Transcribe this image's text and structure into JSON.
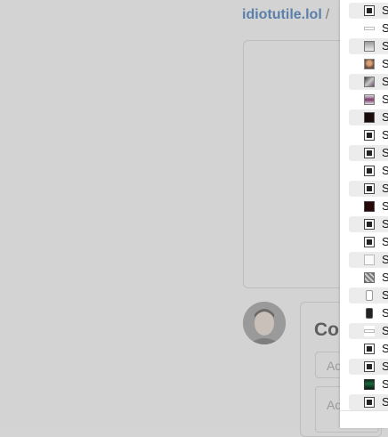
{
  "header": {
    "breadcrumb_site": "idiotutile.lol",
    "breadcrumb_sep": "/"
  },
  "comments": {
    "heading": "Co",
    "field1_placeholder": "Ad",
    "field2_placeholder": "Ad"
  },
  "dropdown": {
    "items": [
      {
        "label": "S",
        "thumb": "dark-screenshot"
      },
      {
        "label": "S",
        "thumb": "light-bar"
      },
      {
        "label": "S",
        "thumb": "landscape-thumb"
      },
      {
        "label": "S",
        "thumb": "portrait-thumb"
      },
      {
        "label": "S",
        "thumb": "photo-thumb"
      },
      {
        "label": "S",
        "thumb": "purple-photo-thumb"
      },
      {
        "label": "S",
        "thumb": "dark-square"
      },
      {
        "label": "S",
        "thumb": "dark-screenshot"
      },
      {
        "label": "S",
        "thumb": "dark-screenshot"
      },
      {
        "label": "S",
        "thumb": "dark-screenshot"
      },
      {
        "label": "S",
        "thumb": "dark-screenshot"
      },
      {
        "label": "S",
        "thumb": "dark-red-square"
      },
      {
        "label": "S",
        "thumb": "dark-screenshot"
      },
      {
        "label": "S",
        "thumb": "dark-screenshot"
      },
      {
        "label": "S",
        "thumb": "sketch-thumb"
      },
      {
        "label": "S",
        "thumb": "grid-thumb"
      },
      {
        "label": "S",
        "thumb": "phone-light-thumb"
      },
      {
        "label": "S",
        "thumb": "phone-dark-thumb"
      },
      {
        "label": "S",
        "thumb": "light-bar"
      },
      {
        "label": "S",
        "thumb": "dark-screenshot"
      },
      {
        "label": "S",
        "thumb": "dark-screenshot"
      },
      {
        "label": "S",
        "thumb": "green-thumb"
      },
      {
        "label": "S",
        "thumb": "dark-screenshot"
      }
    ]
  }
}
